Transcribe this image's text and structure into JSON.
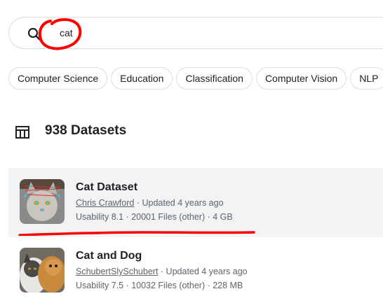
{
  "search": {
    "value": "cat"
  },
  "chips": [
    "Computer Science",
    "Education",
    "Classification",
    "Computer Vision",
    "NLP"
  ],
  "results": {
    "count_label": "938 Datasets"
  },
  "datasets": [
    {
      "title": "Cat Dataset",
      "author": "Chris Crawford",
      "updated": "· Updated 4 years ago",
      "stats": "Usability 8.1 · 20001 Files (other) · 4 GB"
    },
    {
      "title": "Cat and Dog",
      "author": "SchubertSlySchubert",
      "updated": "· Updated 4 years ago",
      "stats": "Usability 7.5 · 10032 Files (other) · 228 MB"
    }
  ],
  "colors": {
    "annotation": "#ff0000",
    "hover_bg": "#f1f3f4",
    "border": "#dadce0"
  },
  "icons": [
    "search-icon",
    "table-icon"
  ]
}
